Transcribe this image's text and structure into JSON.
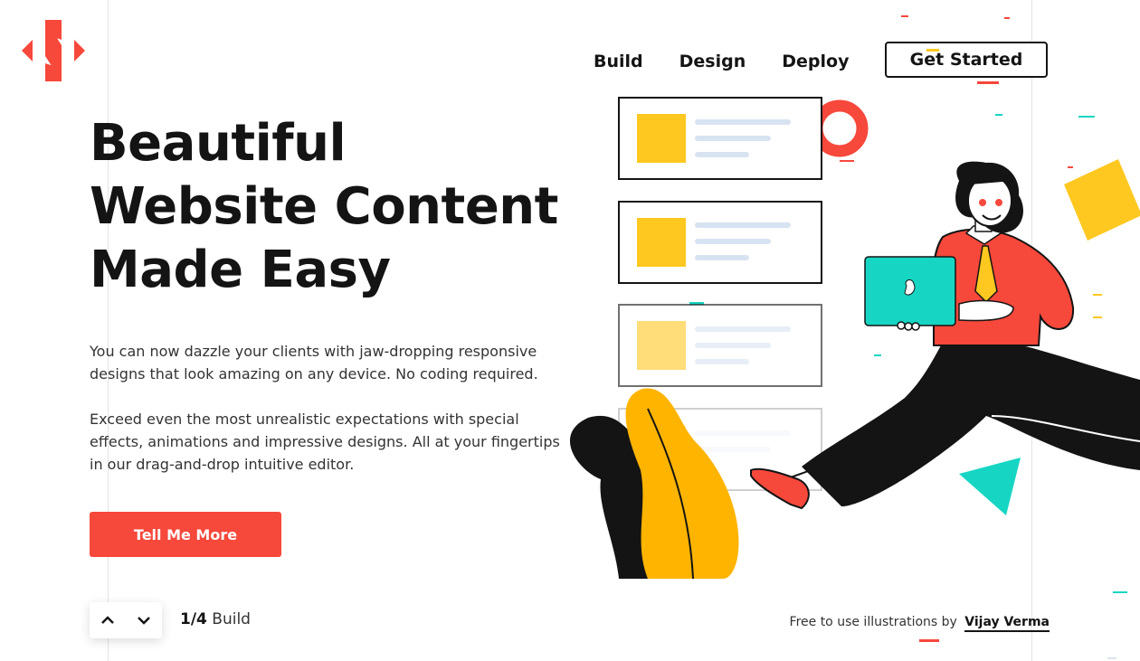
{
  "brand": {
    "logo_icon": "n-logo-icon",
    "accent": "#f6483b",
    "dark": "#141414",
    "yellow": "#ffc820",
    "teal": "#16d6c3"
  },
  "nav": {
    "items": [
      {
        "label": "Build"
      },
      {
        "label": "Design"
      },
      {
        "label": "Deploy"
      }
    ],
    "cta_label": "Get Started"
  },
  "hero": {
    "title_line1": "Beautiful",
    "title_line2": "Website Content",
    "title_line3": "Made Easy",
    "para1_line1": "You can now dazzle your clients with jaw-dropping responsive",
    "para1_line2": "designs that look amazing on any device. No coding required.",
    "para2_line1": "Exceed even the most unrealistic expectations with special",
    "para2_line2": "effects, animations and impressive designs. All at your fingertips",
    "para2_line3": "in our drag-and-drop intuitive editor.",
    "button_label": "Tell Me More"
  },
  "pager": {
    "up_icon": "chevron-up-icon",
    "down_icon": "chevron-down-icon",
    "current": "1/4",
    "section": "Build"
  },
  "credit": {
    "text": "Free to use illustrations by",
    "author": "Vijay Verma"
  }
}
